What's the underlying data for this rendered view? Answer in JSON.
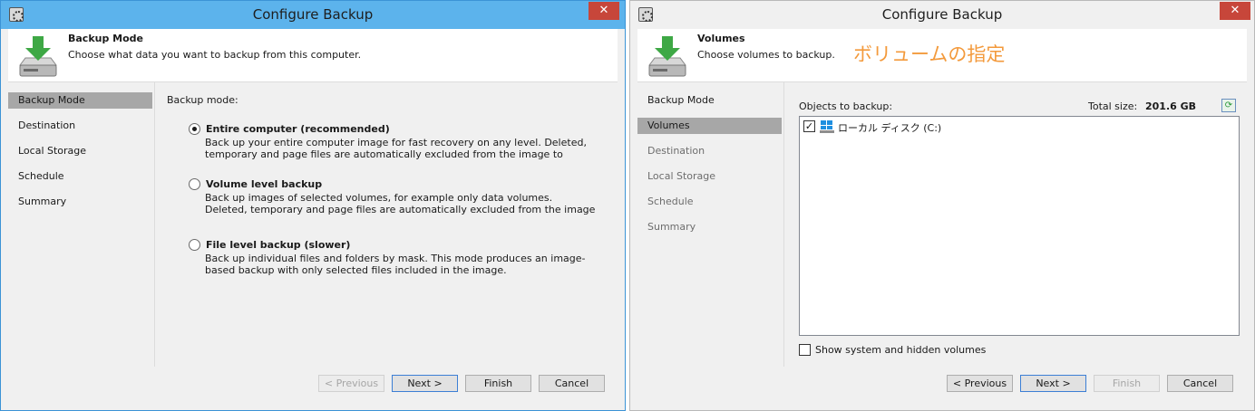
{
  "left": {
    "title": "Configure Backup",
    "close": "✕",
    "header": {
      "title": "Backup Mode",
      "desc": "Choose what data you want to backup from this computer."
    },
    "sidebar": [
      "Backup Mode",
      "Destination",
      "Local Storage",
      "Schedule",
      "Summary"
    ],
    "mode_label": "Backup mode:",
    "options": [
      {
        "title": "Entire computer (recommended)",
        "desc": "Back up your entire computer image for fast recovery on any level. Deleted, temporary and page files are automatically excluded from the image to reduce the"
      },
      {
        "title": "Volume level backup",
        "desc": "Back up images of selected volumes, for example only data volumes. Deleted, temporary and page files are automatically excluded from the image to reduce the"
      },
      {
        "title": "File level backup (slower)",
        "desc": "Back up individual files and folders by mask. This mode produces an image-based backup with only selected files included in the image."
      }
    ],
    "buttons": {
      "previous": "< Previous",
      "next": "Next >",
      "finish": "Finish",
      "cancel": "Cancel"
    }
  },
  "right": {
    "title": "Configure Backup",
    "close": "✕",
    "header": {
      "title": "Volumes",
      "desc": "Choose volumes to backup.",
      "note": "ボリュームの指定"
    },
    "sidebar": [
      "Backup Mode",
      "Volumes",
      "Destination",
      "Local Storage",
      "Schedule",
      "Summary"
    ],
    "objects_label": "Objects to backup:",
    "total_label": "Total size:",
    "total_value": "201.6 GB",
    "volume": {
      "label": "ローカル ディスク (C:)",
      "checked": "✓"
    },
    "hidden_label": "Show system and hidden volumes",
    "buttons": {
      "previous": "< Previous",
      "next": "Next >",
      "finish": "Finish",
      "cancel": "Cancel"
    }
  },
  "colors": {
    "title_active": "#5cb3ec",
    "selected_item": "#a7a7a7",
    "note": "#f39a3c",
    "close": "#c7463a"
  }
}
